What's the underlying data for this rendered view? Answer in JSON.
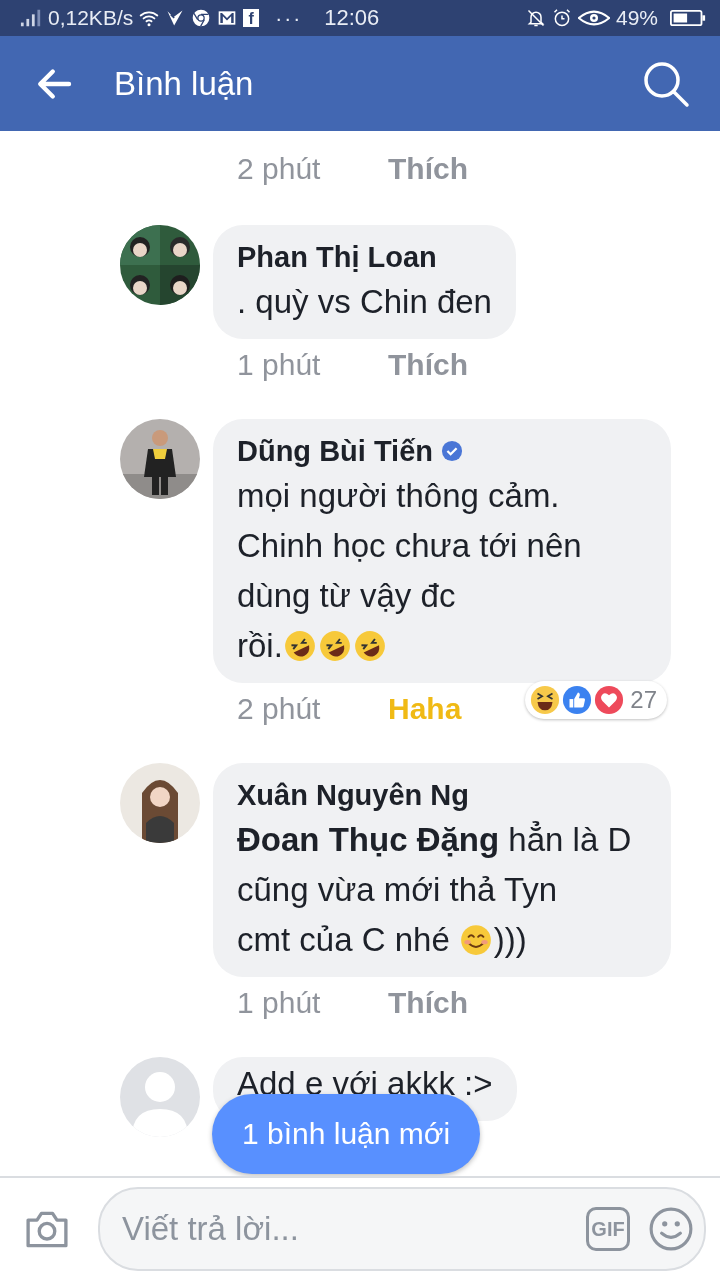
{
  "status_bar": {
    "speed": "0,12KB/s",
    "notifications": [
      {
        "kind": "check"
      },
      {
        "kind": "chrome"
      },
      {
        "kind": "mail"
      },
      {
        "kind": "fb",
        "text": "f"
      }
    ],
    "more": "···",
    "time": "12:06",
    "battery": "49%"
  },
  "header": {
    "title": "Bình luận"
  },
  "comments": [
    {
      "time": "2 phút",
      "action": {
        "label": "Thích",
        "kind": "like"
      }
    },
    {
      "name": "Phan Thị Loan",
      "verified": false,
      "lines": [
        [
          {
            "kind": "text",
            "text": ". quỳ vs Chin đen"
          }
        ]
      ],
      "time": "1 phút",
      "action": {
        "label": "Thích",
        "kind": "like"
      }
    },
    {
      "name": "Dũng Bùi Tiến",
      "verified": true,
      "lines": [
        [
          {
            "kind": "text",
            "text": "mọi người thông cảm. Chinh học chưa tới nên dùng từ vậy đc"
          }
        ],
        [
          {
            "kind": "text",
            "text": "rồi."
          },
          {
            "kind": "rofl"
          },
          {
            "kind": "rofl"
          },
          {
            "kind": "rofl"
          }
        ]
      ],
      "reactions": {
        "types": [
          {
            "kind": "haha"
          },
          {
            "kind": "like"
          },
          {
            "kind": "love"
          }
        ],
        "count": "27"
      },
      "time": "2 phút",
      "action": {
        "label": "Haha",
        "kind": "haha"
      }
    },
    {
      "name": "Xuân Nguyên Ng",
      "verified": false,
      "lines": [
        [
          {
            "kind": "text",
            "text": "**Đoan Thục Đặng** hẳn là D cũng vừa mới thả Tyn"
          }
        ],
        [
          {
            "kind": "text",
            "text": "cmt của C nhé"
          },
          {
            "kind": "smile"
          },
          {
            "kind": "text",
            "text": ")))"
          }
        ]
      ],
      "time": "1 phút",
      "action": {
        "label": "Thích",
        "kind": "like"
      }
    },
    {
      "lines": [
        [
          {
            "kind": "text",
            "text": "Add e với akkk :>"
          }
        ]
      ]
    }
  ],
  "toast": "1 bình luận mới",
  "composer": {
    "placeholder": "Viết trả lời...",
    "gif": "GIF"
  }
}
